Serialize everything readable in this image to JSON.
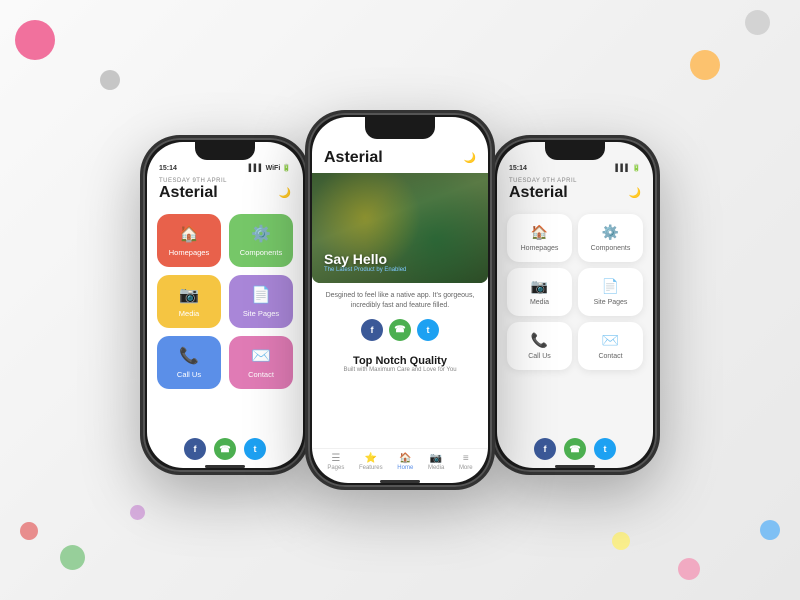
{
  "background": {
    "color": "#f0f0f0"
  },
  "phones": {
    "left": {
      "theme": "dark",
      "status_time": "15:14",
      "date_label": "TUESDAY 9TH APRIL",
      "title": "Asterial",
      "menu_items": [
        {
          "label": "Homepages",
          "icon": "🏠",
          "color_class": "item-orange"
        },
        {
          "label": "Components",
          "icon": "⚙️",
          "color_class": "item-green"
        },
        {
          "label": "Media",
          "icon": "📷",
          "color_class": "item-yellow"
        },
        {
          "label": "Site Pages",
          "icon": "📄",
          "color_class": "item-purple"
        },
        {
          "label": "Call Us",
          "icon": "📞",
          "color_class": "item-blue"
        },
        {
          "label": "Contact",
          "icon": "✉️",
          "color_class": "item-pink"
        }
      ],
      "social": [
        "f",
        "☎",
        "t"
      ]
    },
    "center": {
      "theme": "light",
      "title": "Asterial",
      "hero_title": "Say Hello",
      "hero_subtitle": "The Latest Product by Enabled",
      "description": "Desgined to feel like a native app. It's gorgeous, incredibly fast and feature filled.",
      "top_notch_title": "Top Notch Quality",
      "top_notch_subtitle": "Built with Maximum Care and Love for You",
      "nav_items": [
        {
          "label": "Pages",
          "icon": "☰",
          "active": false
        },
        {
          "label": "Features",
          "icon": "⭐",
          "active": false
        },
        {
          "label": "Home",
          "icon": "🏠",
          "active": true
        },
        {
          "label": "Media",
          "icon": "📷",
          "active": false
        },
        {
          "label": "More",
          "icon": "≡",
          "active": false
        }
      ]
    },
    "right": {
      "theme": "light_white",
      "status_time": "15:14",
      "date_label": "TUESDAY 9TH APRIL",
      "title": "Asterial",
      "menu_items": [
        {
          "label": "Homepages",
          "icon_class": "icon-orange",
          "icon": "🏠"
        },
        {
          "label": "Components",
          "icon_class": "icon-purple",
          "icon": "⚙️"
        },
        {
          "label": "Media",
          "icon_class": "icon-green",
          "icon": "📷"
        },
        {
          "label": "Site Pages",
          "icon_class": "icon-yellow",
          "icon": "📄"
        },
        {
          "label": "Call Us",
          "icon_class": "icon-red",
          "icon": "📞"
        },
        {
          "label": "Contact",
          "icon_class": "icon-blue",
          "icon": "✉️"
        }
      ],
      "social": [
        "f",
        "☎",
        "t"
      ]
    }
  },
  "decorative_dots": [
    {
      "class": "deco-dot-pink-tl"
    },
    {
      "class": "deco-dot-gray-tl"
    },
    {
      "class": "deco-dot-gray-tr"
    },
    {
      "class": "deco-dot-orange-tr"
    },
    {
      "class": "deco-dot-blue-br"
    },
    {
      "class": "deco-dot-green-bl"
    },
    {
      "class": "deco-dot-red-bl"
    },
    {
      "class": "deco-dot-pink-br"
    },
    {
      "class": "deco-dot-yellow-br"
    },
    {
      "class": "deco-dot-purple-bl"
    }
  ]
}
